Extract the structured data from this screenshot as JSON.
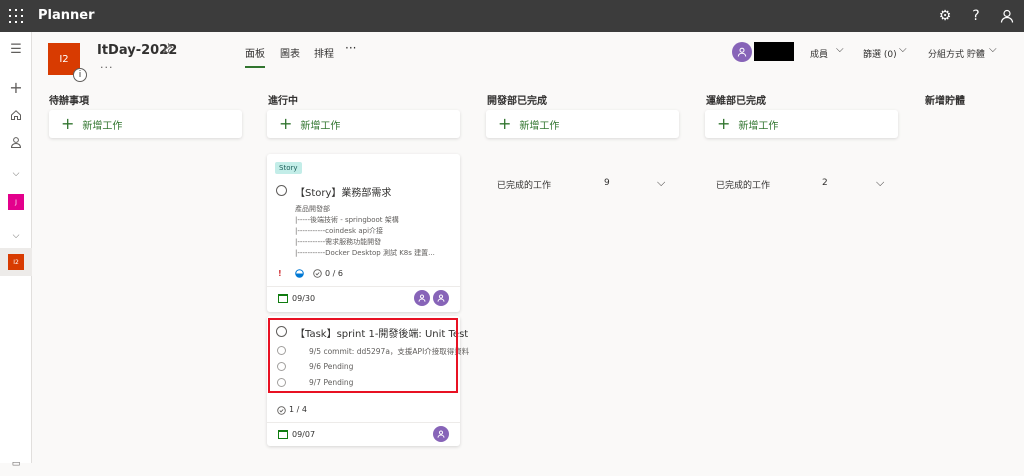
{
  "app": {
    "name": "Planner"
  },
  "topbar_icons": [
    "gear-icon",
    "help-icon",
    "person-icon"
  ],
  "rail": {
    "icons": [
      "menu-icon",
      "plus-icon",
      "home-icon",
      "person-icon",
      "chevron-down-icon",
      "chevron-down-icon",
      "bottom-icon"
    ],
    "plans": [
      {
        "label": "J",
        "color": "#e3008c"
      },
      {
        "label": "I2",
        "color": "#d83b01"
      }
    ]
  },
  "plan": {
    "logo": "I2",
    "logo_color": "#d83b01",
    "title": "ItDay-2022",
    "info": "i",
    "more": "...",
    "pin_icon": "pin-icon"
  },
  "views": {
    "tabs": [
      {
        "label": "面板",
        "active": true
      },
      {
        "label": "圖表",
        "active": false
      },
      {
        "label": "排程",
        "active": false
      }
    ],
    "more": "···"
  },
  "header": {
    "members": "成員",
    "filter": "篩選 (0)",
    "group_by": "分組方式 貯體",
    "chevron": "⌵"
  },
  "buckets": [
    {
      "title": "待辦事項",
      "add_label": "新增工作"
    },
    {
      "title": "進行中",
      "add_label": "新增工作"
    },
    {
      "title": "開發部已完成",
      "add_label": "新增工作",
      "completed_label": "已完成的工作",
      "completed_count": "9"
    },
    {
      "title": "運維部已完成",
      "add_label": "新增工作",
      "completed_label": "已完成的工作",
      "completed_count": "2"
    },
    {
      "title": "新增貯體"
    }
  ],
  "cards": {
    "story": {
      "tag": "Story",
      "title": "【Story】業務部需求",
      "description": "產品開發部\n|-----後端技術 - springboot 架構\n|-----------coindesk api介接\n|-----------需求服務功能開發\n|-----------Docker Desktop 測試 K8s 建置...",
      "priority_icon": "!",
      "progress_icon": "half-circle-icon",
      "checklist": "0 / 6",
      "due": "09/30",
      "assignees": 2
    },
    "task": {
      "title": "【Task】sprint 1-開發後端: Unit Test",
      "subtasks": [
        "9/5 commit: dd5297a，支援API介接取得資料",
        "9/6 Pending",
        "9/7 Pending"
      ],
      "checklist": "1 / 4",
      "due": "09/07",
      "assignees": 1
    }
  },
  "colors": {
    "topbar": "#3c3c3c",
    "accent_green": "#31752f",
    "avatar": "#8764b8",
    "highlight_red": "#e81123",
    "tag_bg": "#c3ede8"
  }
}
